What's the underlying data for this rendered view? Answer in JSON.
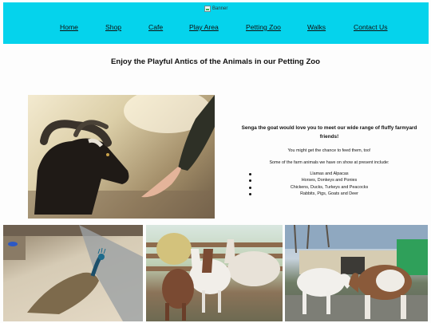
{
  "header": {
    "banner_alt": "Banner",
    "background_color": "#05d3ec",
    "nav": [
      {
        "label": "Home"
      },
      {
        "label": "Shop"
      },
      {
        "label": "Cafe"
      },
      {
        "label": "Play Area"
      },
      {
        "label": "Petting Zoo"
      },
      {
        "label": "Walks"
      },
      {
        "label": "Contact Us"
      }
    ]
  },
  "main": {
    "title": "Enjoy the Playful Antics of the Animals in our Petting Zoo",
    "lead": "Senga the goat would love you to meet our wide range of fluffy farmyard friends!",
    "paragraph1": "You might get the chance to feed them, too!",
    "paragraph2": "Some of the farm animals we have on show at present include:",
    "animals": [
      "Llamas and Alpacas",
      "Horses, Donkeys and Ponies",
      "Chickens, Ducks, Turkeys and Peacocks",
      "Rabbits, Pigs, Goats and Deer"
    ]
  }
}
